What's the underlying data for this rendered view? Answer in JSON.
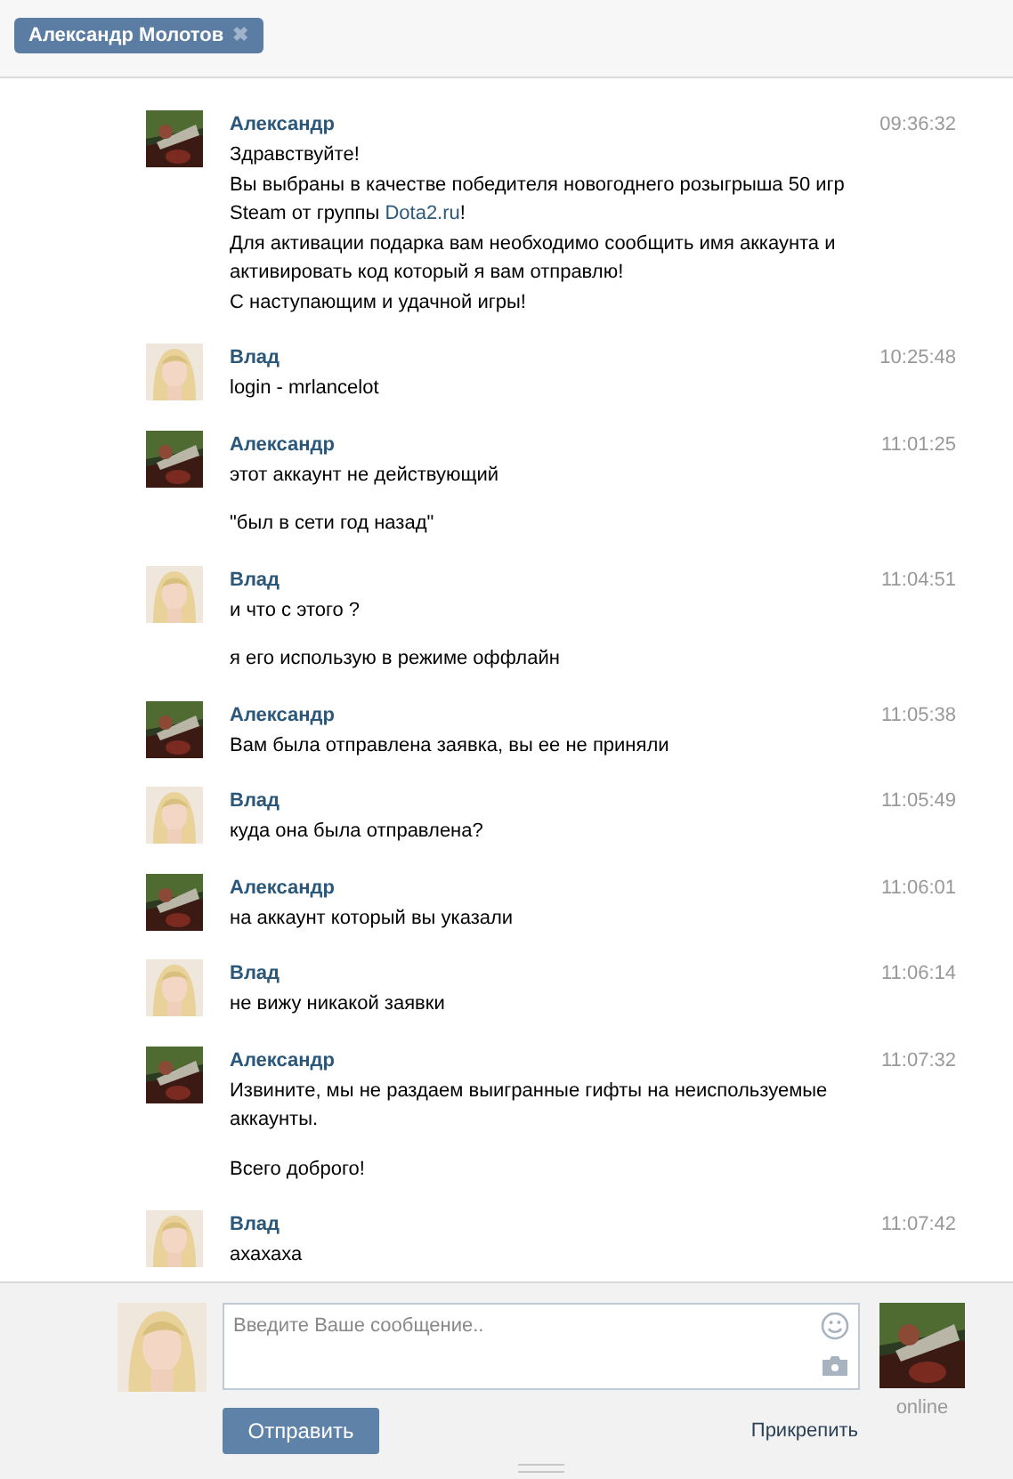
{
  "tab": {
    "title": "Александр Молотов",
    "close": "✖"
  },
  "messages": [
    {
      "author": "Александр",
      "kind": "other",
      "time": "09:36:32",
      "paragraphs": [
        [
          [
            {
              "kind": "text",
              "text": "Здравствуйте!"
            }
          ],
          [
            {
              "kind": "text",
              "text": "Вы выбраны в качестве победителя новогоднего розыгрыша 50 игр"
            }
          ],
          [
            {
              "kind": "text",
              "text": "Steam от группы "
            },
            {
              "kind": "link",
              "text": "Dota2.ru"
            },
            {
              "kind": "text",
              "text": "!"
            }
          ],
          [
            {
              "kind": "text",
              "text": "Для активации подарка вам необходимо сообщить имя аккаунта и"
            }
          ],
          [
            {
              "kind": "text",
              "text": "активировать код который я вам отправлю!"
            }
          ],
          [
            {
              "kind": "text",
              "text": "С наступающим и удачной игры!"
            }
          ]
        ]
      ]
    },
    {
      "author": "Влад",
      "kind": "self",
      "time": "10:25:48",
      "paragraphs": [
        [
          [
            {
              "kind": "text",
              "text": "login - mrlancelot"
            }
          ]
        ]
      ]
    },
    {
      "author": "Александр",
      "kind": "other",
      "time": "11:01:25",
      "paragraphs": [
        [
          [
            {
              "kind": "text",
              "text": "этот аккаунт не действующий"
            }
          ]
        ],
        [
          [
            {
              "kind": "text",
              "text": "\"был в сети год назад\""
            }
          ]
        ]
      ]
    },
    {
      "author": "Влад",
      "kind": "self",
      "time": "11:04:51",
      "paragraphs": [
        [
          [
            {
              "kind": "text",
              "text": "и что с этого ?"
            }
          ]
        ],
        [
          [
            {
              "kind": "text",
              "text": "я его использую в режиме оффлайн"
            }
          ]
        ]
      ]
    },
    {
      "author": "Александр",
      "kind": "other",
      "time": "11:05:38",
      "paragraphs": [
        [
          [
            {
              "kind": "text",
              "text": "Вам была отправлена заявка, вы ее не приняли"
            }
          ]
        ]
      ]
    },
    {
      "author": "Влад",
      "kind": "self",
      "time": "11:05:49",
      "paragraphs": [
        [
          [
            {
              "kind": "text",
              "text": "куда она была отправлена?"
            }
          ]
        ]
      ]
    },
    {
      "author": "Александр",
      "kind": "other",
      "time": "11:06:01",
      "paragraphs": [
        [
          [
            {
              "kind": "text",
              "text": "на аккаунт который вы указали"
            }
          ]
        ]
      ]
    },
    {
      "author": "Влад",
      "kind": "self",
      "time": "11:06:14",
      "paragraphs": [
        [
          [
            {
              "kind": "text",
              "text": "не вижу никакой заявки"
            }
          ]
        ]
      ]
    },
    {
      "author": "Александр",
      "kind": "other",
      "time": "11:07:32",
      "paragraphs": [
        [
          [
            {
              "kind": "text",
              "text": "Извините, мы не раздаем выигранные гифты на неиспользуемые"
            }
          ],
          [
            {
              "kind": "text",
              "text": "аккаунты."
            }
          ]
        ],
        [
          [
            {
              "kind": "text",
              "text": "Всего доброго!"
            }
          ]
        ]
      ]
    },
    {
      "author": "Влад",
      "kind": "self",
      "time": "11:07:42",
      "paragraphs": [
        [
          [
            {
              "kind": "text",
              "text": "ахахаха"
            }
          ]
        ]
      ]
    }
  ],
  "composer": {
    "placeholder": "Введите Ваше сообщение..",
    "send": "Отправить",
    "attach": "Прикрепить",
    "status": "online"
  }
}
